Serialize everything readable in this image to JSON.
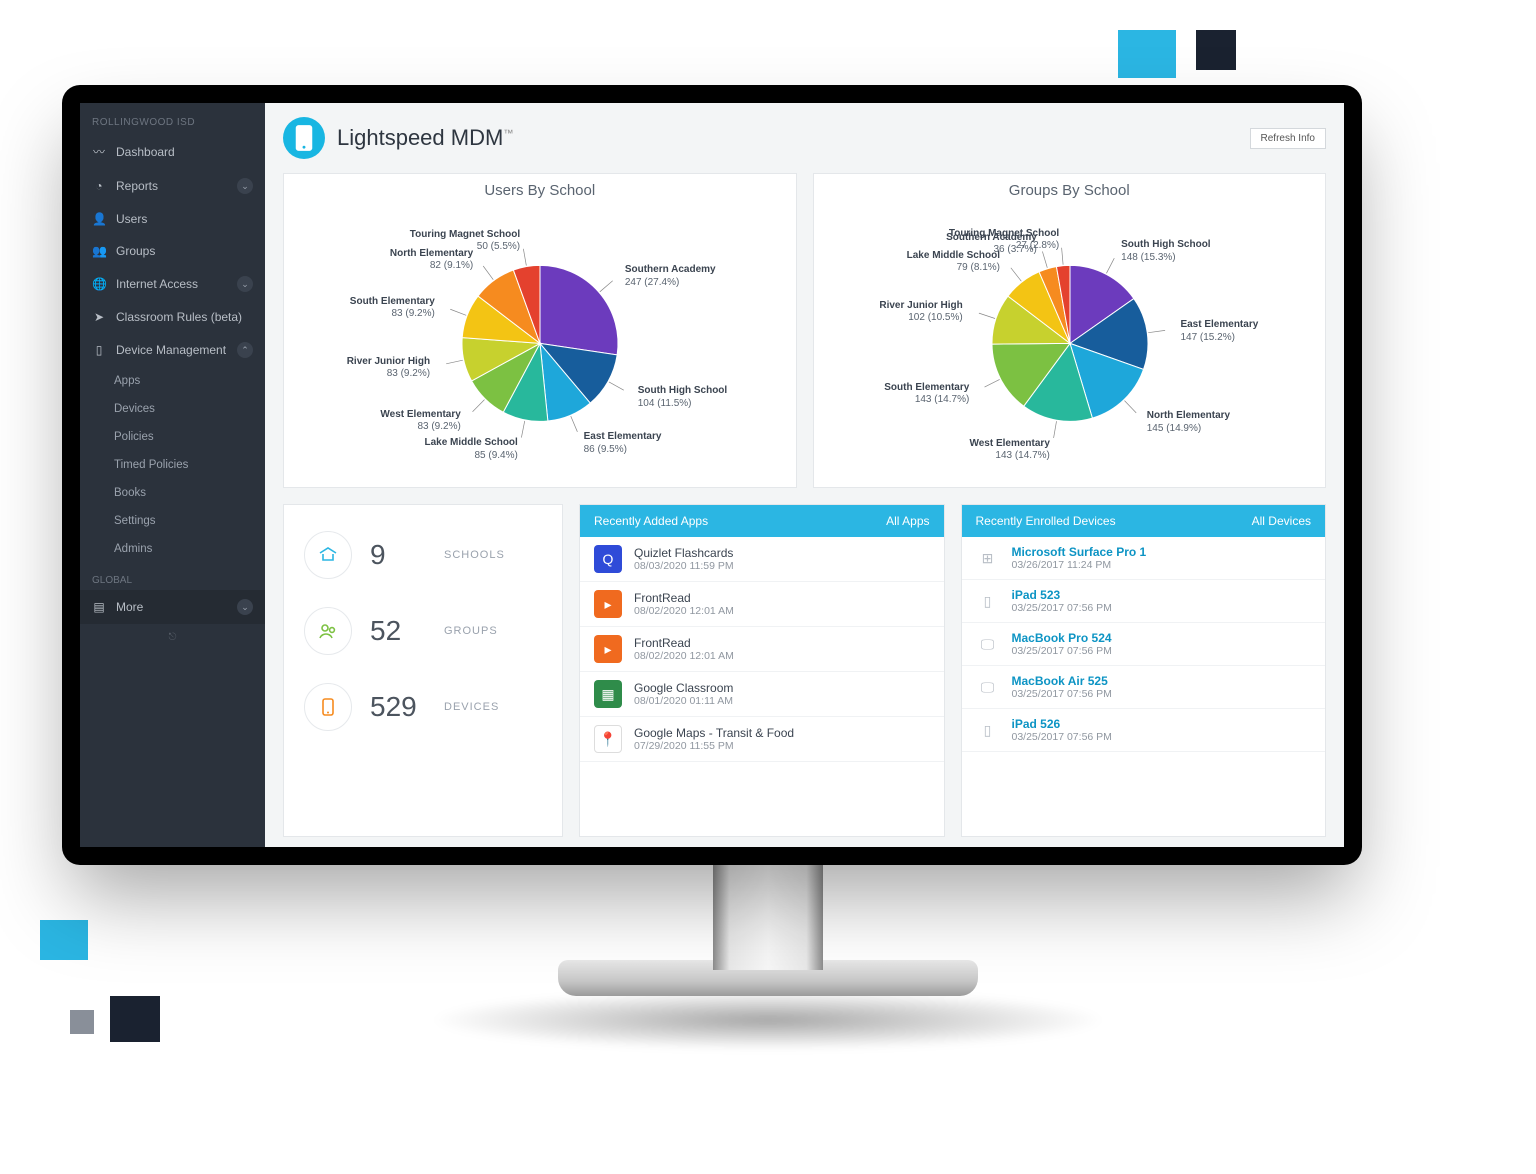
{
  "decor": {},
  "sidebar": {
    "org": "ROLLINGWOOD ISD",
    "items": [
      {
        "icon": "chart-line",
        "label": "Dashboard",
        "chev": false
      },
      {
        "icon": "pie",
        "label": "Reports",
        "chev": true
      },
      {
        "icon": "user",
        "label": "Users",
        "chev": false
      },
      {
        "icon": "users",
        "label": "Groups",
        "chev": false
      },
      {
        "icon": "globe",
        "label": "Internet Access",
        "chev": true
      },
      {
        "icon": "paper-plane",
        "label": "Classroom Rules (beta)",
        "chev": false
      },
      {
        "icon": "tablet",
        "label": "Device Management",
        "chev": true,
        "expanded": true
      }
    ],
    "subitems": [
      "Apps",
      "Devices",
      "Policies",
      "Timed Policies",
      "Books",
      "Settings",
      "Admins"
    ],
    "global_label": "GLOBAL",
    "more_label": "More"
  },
  "header": {
    "title": "Lightspeed MDM",
    "tm": "™",
    "refresh": "Refresh Info"
  },
  "stats": {
    "schools": {
      "value": "9",
      "label": "SCHOOLS"
    },
    "groups": {
      "value": "52",
      "label": "GROUPS"
    },
    "devices": {
      "value": "529",
      "label": "DEVICES"
    }
  },
  "apps_panel": {
    "title": "Recently Added Apps",
    "link": "All Apps",
    "rows": [
      {
        "name": "Quizlet Flashcards",
        "time": "08/03/2020 11:59 PM",
        "bg": "#2f4bd8",
        "glyph": "Q"
      },
      {
        "name": "FrontRead",
        "time": "08/02/2020 12:01 AM",
        "bg": "#f06a1f",
        "glyph": "▸"
      },
      {
        "name": "FrontRead",
        "time": "08/02/2020 12:01 AM",
        "bg": "#f06a1f",
        "glyph": "▸"
      },
      {
        "name": "Google Classroom",
        "time": "08/01/2020 01:11 AM",
        "bg": "#2f8c4a",
        "glyph": "▦"
      },
      {
        "name": "Google Maps - Transit & Food",
        "time": "07/29/2020 11:55 PM",
        "bg": "#ffffff",
        "glyph": "📍"
      }
    ]
  },
  "devices_panel": {
    "title": "Recently Enrolled Devices",
    "link": "All Devices",
    "rows": [
      {
        "name": "Microsoft Surface Pro 1",
        "time": "03/26/2017 11:24 PM",
        "glyph": "⊞"
      },
      {
        "name": "iPad 523",
        "time": "03/25/2017 07:56 PM",
        "glyph": "▯"
      },
      {
        "name": "MacBook Pro 524",
        "time": "03/25/2017 07:56 PM",
        "glyph": "🖵"
      },
      {
        "name": "MacBook Air 525",
        "time": "03/25/2017 07:56 PM",
        "glyph": "🖵"
      },
      {
        "name": "iPad 526",
        "time": "03/25/2017 07:56 PM",
        "glyph": "▯"
      }
    ]
  },
  "chart_data": [
    {
      "type": "pie",
      "title": "Users By School",
      "series": [
        {
          "name": "Southern Academy",
          "value": 247,
          "pct": 27.4,
          "color": "#6c3bbd"
        },
        {
          "name": "South High School",
          "value": 104,
          "pct": 11.5,
          "color": "#175d9c"
        },
        {
          "name": "East Elementary",
          "value": 86,
          "pct": 9.5,
          "color": "#1ea7da"
        },
        {
          "name": "Lake Middle School",
          "value": 85,
          "pct": 9.4,
          "color": "#28b89c"
        },
        {
          "name": "West Elementary",
          "value": 83,
          "pct": 9.2,
          "color": "#7cc142"
        },
        {
          "name": "River Junior High",
          "value": 83,
          "pct": 9.2,
          "color": "#c7d12e"
        },
        {
          "name": "South Elementary",
          "value": 83,
          "pct": 9.2,
          "color": "#f3c414"
        },
        {
          "name": "North Elementary",
          "value": 82,
          "pct": 9.1,
          "color": "#f68b1f"
        },
        {
          "name": "Touring Magnet School",
          "value": 50,
          "pct": 5.5,
          "color": "#e4412e"
        }
      ]
    },
    {
      "type": "pie",
      "title": "Groups By School",
      "series": [
        {
          "name": "South High School",
          "value": 148,
          "pct": 15.3,
          "color": "#6c3bbd"
        },
        {
          "name": "East Elementary",
          "value": 147,
          "pct": 15.2,
          "color": "#175d9c"
        },
        {
          "name": "North Elementary",
          "value": 145,
          "pct": 14.9,
          "color": "#1ea7da"
        },
        {
          "name": "West Elementary",
          "value": 143,
          "pct": 14.7,
          "color": "#28b89c"
        },
        {
          "name": "South Elementary",
          "value": 143,
          "pct": 14.7,
          "color": "#7cc142"
        },
        {
          "name": "River Junior High",
          "value": 102,
          "pct": 10.5,
          "color": "#c7d12e"
        },
        {
          "name": "Lake Middle School",
          "value": 79,
          "pct": 8.1,
          "color": "#f3c414"
        },
        {
          "name": "Southern Academy",
          "value": 36,
          "pct": 3.7,
          "color": "#f68b1f"
        },
        {
          "name": "Touring Magnet School",
          "value": 27,
          "pct": 2.8,
          "color": "#e4412e"
        }
      ]
    }
  ]
}
